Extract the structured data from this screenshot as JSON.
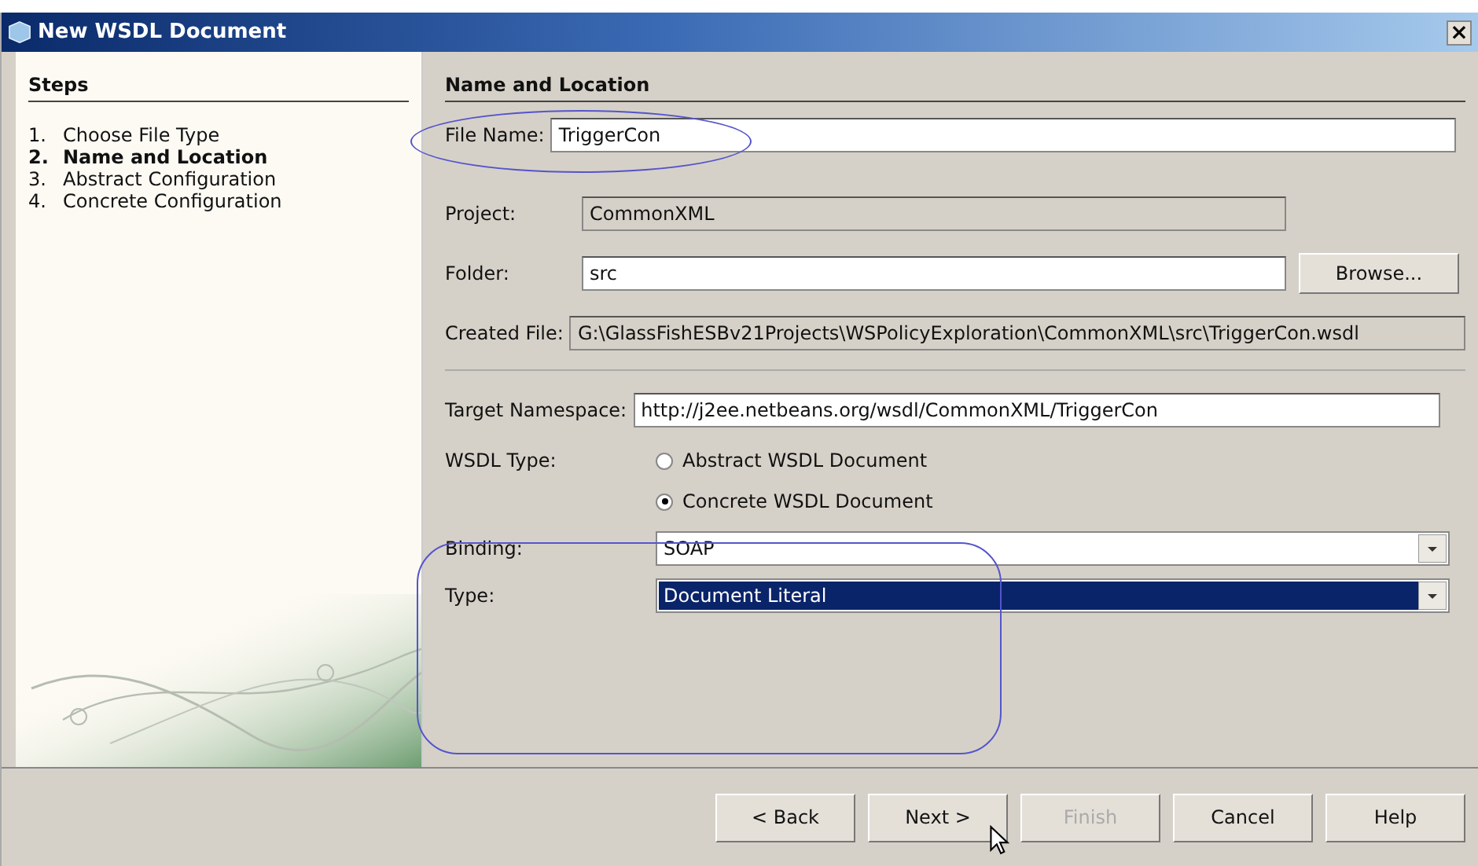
{
  "window": {
    "title": "New WSDL Document",
    "close": "×"
  },
  "steps": {
    "title": "Steps",
    "items": [
      {
        "number": "1.",
        "label": "Choose File Type",
        "selected": false
      },
      {
        "number": "2.",
        "label": "Name and Location",
        "selected": true
      },
      {
        "number": "3.",
        "label": "Abstract Configuration",
        "selected": false
      },
      {
        "number": "4.",
        "label": "Concrete Configuration",
        "selected": false
      }
    ]
  },
  "panel": {
    "title": "Name and Location",
    "file_name": {
      "label": "File Name:",
      "value": "TriggerCon"
    },
    "project": {
      "label": "Project:",
      "value": "CommonXML",
      "disabled": true
    },
    "folder": {
      "label": "Folder:",
      "value": "src",
      "button": "Browse..."
    },
    "created_file": {
      "label": "Created File:",
      "value": "G:\\GlassFishESBv21Projects\\WSPolicyExploration\\CommonXML\\src\\TriggerCon.wsdl",
      "disabled": true
    },
    "target_namespace": {
      "label": "Target Namespace:",
      "value": "http://j2ee.netbeans.org/wsdl/CommonXML/TriggerCon"
    },
    "wsdl_type": {
      "label": "WSDL Type:",
      "options": [
        {
          "label": "Abstract WSDL Document",
          "selected": false
        },
        {
          "label": "Concrete WSDL Document",
          "selected": true
        }
      ]
    },
    "binding": {
      "label": "Binding:",
      "value": "SOAP",
      "focused": false
    },
    "type": {
      "label": "Type:",
      "value": "Document Literal",
      "focused": true
    }
  },
  "buttons": [
    {
      "label": "< Back",
      "disabled": false
    },
    {
      "label": "Next >",
      "disabled": false
    },
    {
      "label": "Finish",
      "disabled": true
    },
    {
      "label": "Cancel",
      "disabled": false
    },
    {
      "label": "Help",
      "disabled": false
    }
  ]
}
